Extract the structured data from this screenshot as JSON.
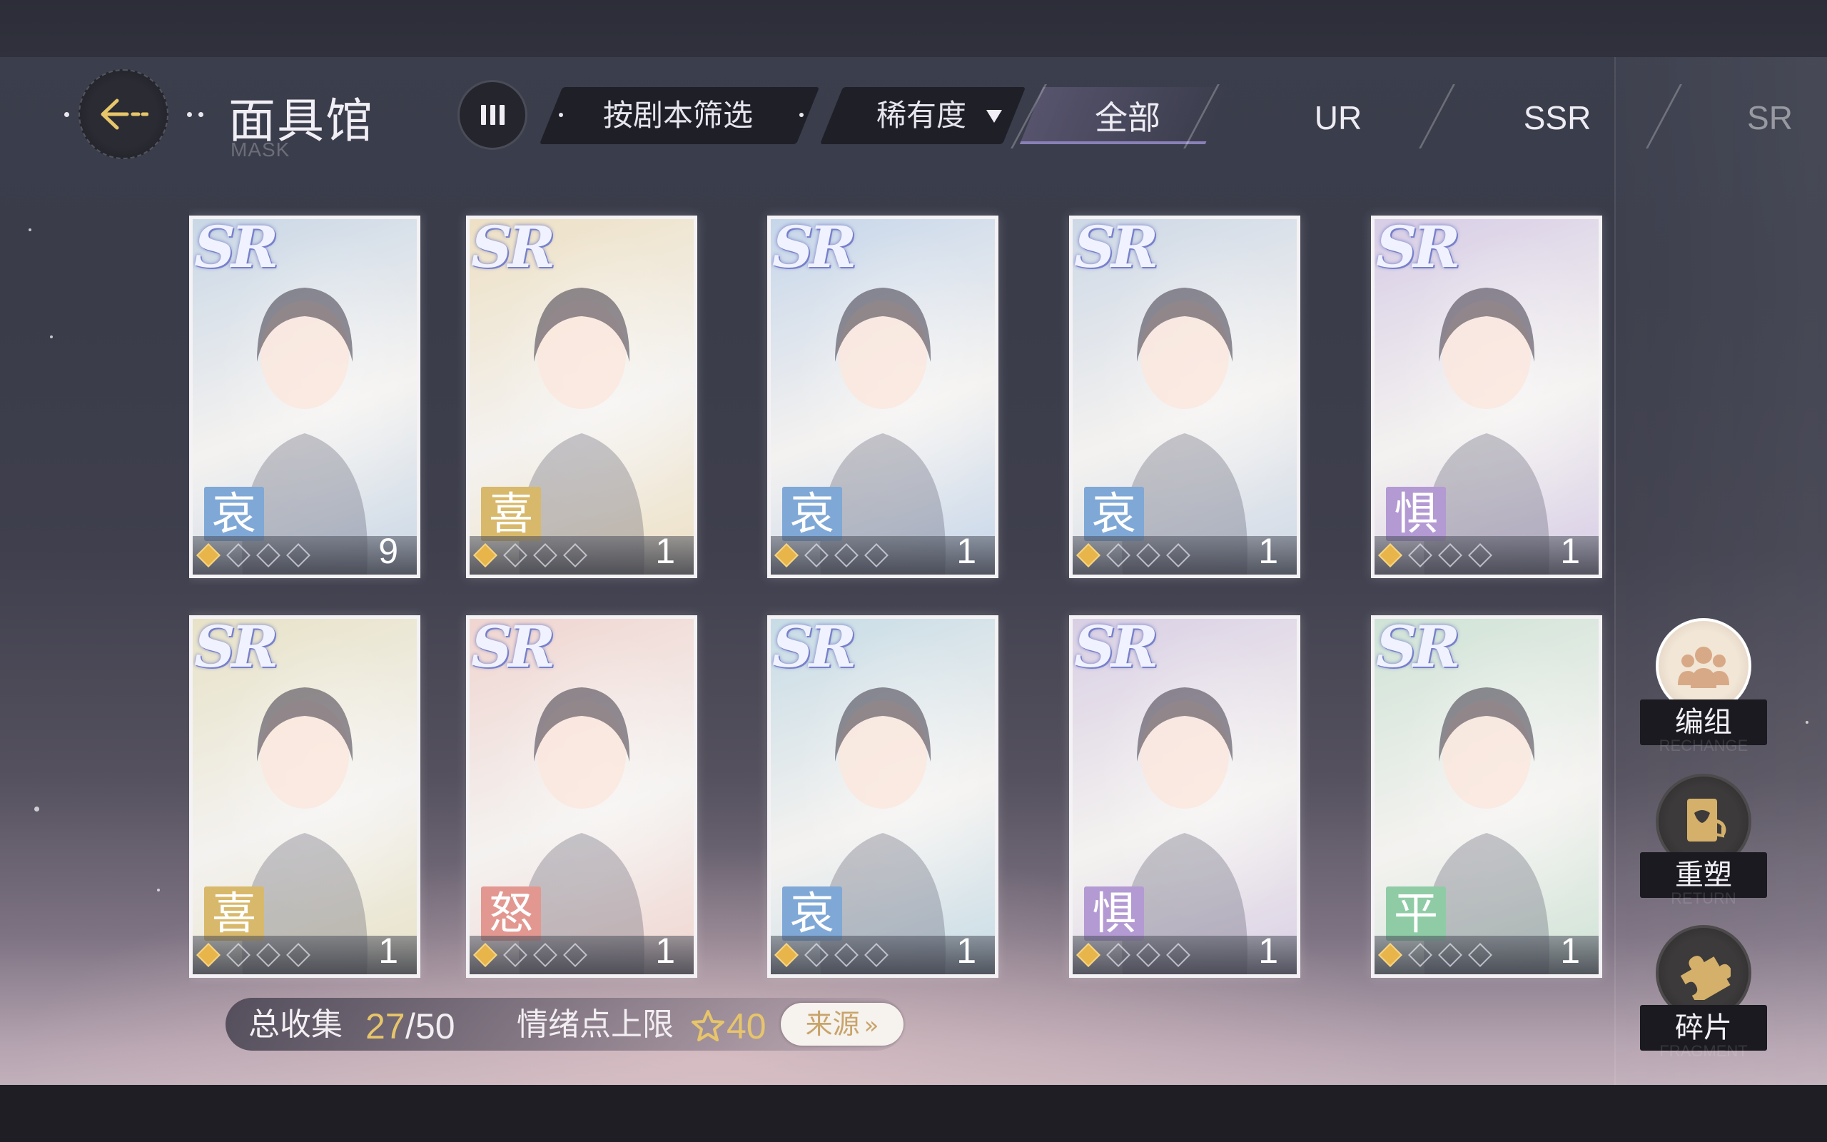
{
  "header": {
    "title": "面具馆",
    "subtitle": "MASK",
    "filter_script_label": "按剧本筛选",
    "filter_rarity_label": "稀有度",
    "tabs": [
      {
        "label": "全部",
        "active": true
      },
      {
        "label": "UR",
        "active": false
      },
      {
        "label": "SSR",
        "active": false
      },
      {
        "label": "SR",
        "active": false
      }
    ]
  },
  "masks": [
    {
      "rarity": "SR",
      "emotion": "哀",
      "stars_filled": 1,
      "stars_total": 4,
      "count": "9",
      "bg": "#c9d7e6",
      "emotion_color": "#7fa8d6"
    },
    {
      "rarity": "SR",
      "emotion": "喜",
      "stars_filled": 1,
      "stars_total": 4,
      "count": "1",
      "bg": "#ede0c4",
      "emotion_color": "#d8b86a"
    },
    {
      "rarity": "SR",
      "emotion": "哀",
      "stars_filled": 1,
      "stars_total": 4,
      "count": "1",
      "bg": "#c6d6ea",
      "emotion_color": "#7fa8d6"
    },
    {
      "rarity": "SR",
      "emotion": "哀",
      "stars_filled": 1,
      "stars_total": 4,
      "count": "1",
      "bg": "#cdd8e6",
      "emotion_color": "#7fa8d6"
    },
    {
      "rarity": "SR",
      "emotion": "惧",
      "stars_filled": 1,
      "stars_total": 4,
      "count": "1",
      "bg": "#d7cde6",
      "emotion_color": "#b39ad3"
    },
    {
      "rarity": "SR",
      "emotion": "喜",
      "stars_filled": 1,
      "stars_total": 4,
      "count": "1",
      "bg": "#e7e2c7",
      "emotion_color": "#d8b86a"
    },
    {
      "rarity": "SR",
      "emotion": "怒",
      "stars_filled": 1,
      "stars_total": 4,
      "count": "1",
      "bg": "#f0d5d0",
      "emotion_color": "#e29890"
    },
    {
      "rarity": "SR",
      "emotion": "哀",
      "stars_filled": 1,
      "stars_total": 4,
      "count": "1",
      "bg": "#c7dce6",
      "emotion_color": "#7fa8d6"
    },
    {
      "rarity": "SR",
      "emotion": "惧",
      "stars_filled": 1,
      "stars_total": 4,
      "count": "1",
      "bg": "#d9cfe4",
      "emotion_color": "#b39ad3"
    },
    {
      "rarity": "SR",
      "emotion": "平",
      "stars_filled": 1,
      "stars_total": 4,
      "count": "1",
      "bg": "#cfe3d6",
      "emotion_color": "#8fcca6"
    }
  ],
  "side_buttons": [
    {
      "label": "编组",
      "sub": "RECHANGE",
      "icon": "team-icon"
    },
    {
      "label": "重塑",
      "sub": "RETURN",
      "icon": "remold-icon"
    },
    {
      "label": "碎片",
      "sub": "FRAGMENT",
      "icon": "puzzle-icon"
    }
  ],
  "stats": {
    "collection_label": "总收集",
    "collection_current": "27",
    "collection_total": "/50",
    "emotion_cap_label": "情绪点上限",
    "emotion_cap_value": "40",
    "source_button": "来源"
  },
  "colors": {
    "accent_gold": "#e7c56a",
    "tab_active_underline": "#8a80b8"
  }
}
